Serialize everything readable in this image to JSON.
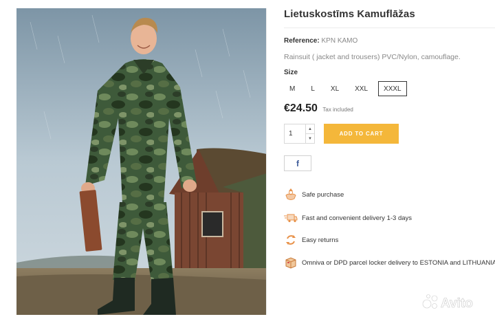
{
  "product": {
    "title": "Lietuskostīms Kamuflāžas",
    "reference_label": "Reference:",
    "reference_value": "KPN KAMO",
    "description": "Rainsuit ( jacket and trousers) PVC/Nylon, camouflage.",
    "image_alt": "Man wearing camouflage rainsuit in front of a wooden hut"
  },
  "size": {
    "label": "Size",
    "options": [
      "M",
      "L",
      "XL",
      "XXL",
      "XXXL"
    ],
    "selected": "XXXL"
  },
  "price": {
    "value": "€24.50",
    "tax_note": "Tax included"
  },
  "cart": {
    "quantity": "1",
    "add_label": "ADD TO CART"
  },
  "share": {
    "facebook": "f"
  },
  "benefits": [
    {
      "icon": "safe-purchase-icon",
      "text": "Safe purchase"
    },
    {
      "icon": "delivery-truck-icon",
      "text": "Fast and convenient delivery 1-3 days"
    },
    {
      "icon": "returns-icon",
      "text": "Easy returns"
    },
    {
      "icon": "parcel-box-icon",
      "text": "Omniva or DPD parcel locker delivery to ESTONIA and LITHUANIA"
    }
  ],
  "watermark": "Avito",
  "colors": {
    "accent": "#f4b73a",
    "facebook": "#3b5998",
    "icon_orange": "#e8924a"
  }
}
